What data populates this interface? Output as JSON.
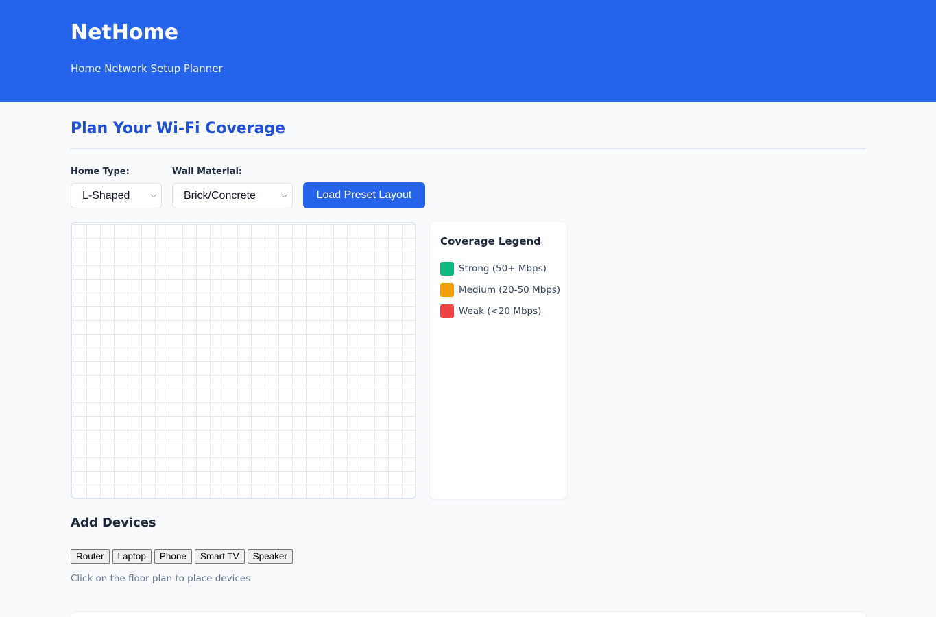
{
  "header": {
    "brand": "NetHome",
    "tagline": "Home Network Setup Planner",
    "background_color": "#2563eb"
  },
  "planner": {
    "title": "Plan Your Wi-Fi Coverage",
    "home_type": {
      "label": "Home Type:",
      "selected": "L-Shaped"
    },
    "wall_material": {
      "label": "Wall Material:",
      "selected": "Brick/Concrete"
    },
    "load_button": "Load Preset Layout"
  },
  "legend": {
    "title": "Coverage Legend",
    "items": [
      {
        "label": "Strong (50+ Mbps)",
        "color": "#10b981"
      },
      {
        "label": "Medium (20-50 Mbps)",
        "color": "#f59e0b"
      },
      {
        "label": "Weak (<20 Mbps)",
        "color": "#ef4444"
      }
    ]
  },
  "devices": {
    "title": "Add Devices",
    "buttons": [
      "Router",
      "Laptop",
      "Phone",
      "Smart TV",
      "Speaker"
    ],
    "hint": "Click on the floor plan to place devices"
  }
}
